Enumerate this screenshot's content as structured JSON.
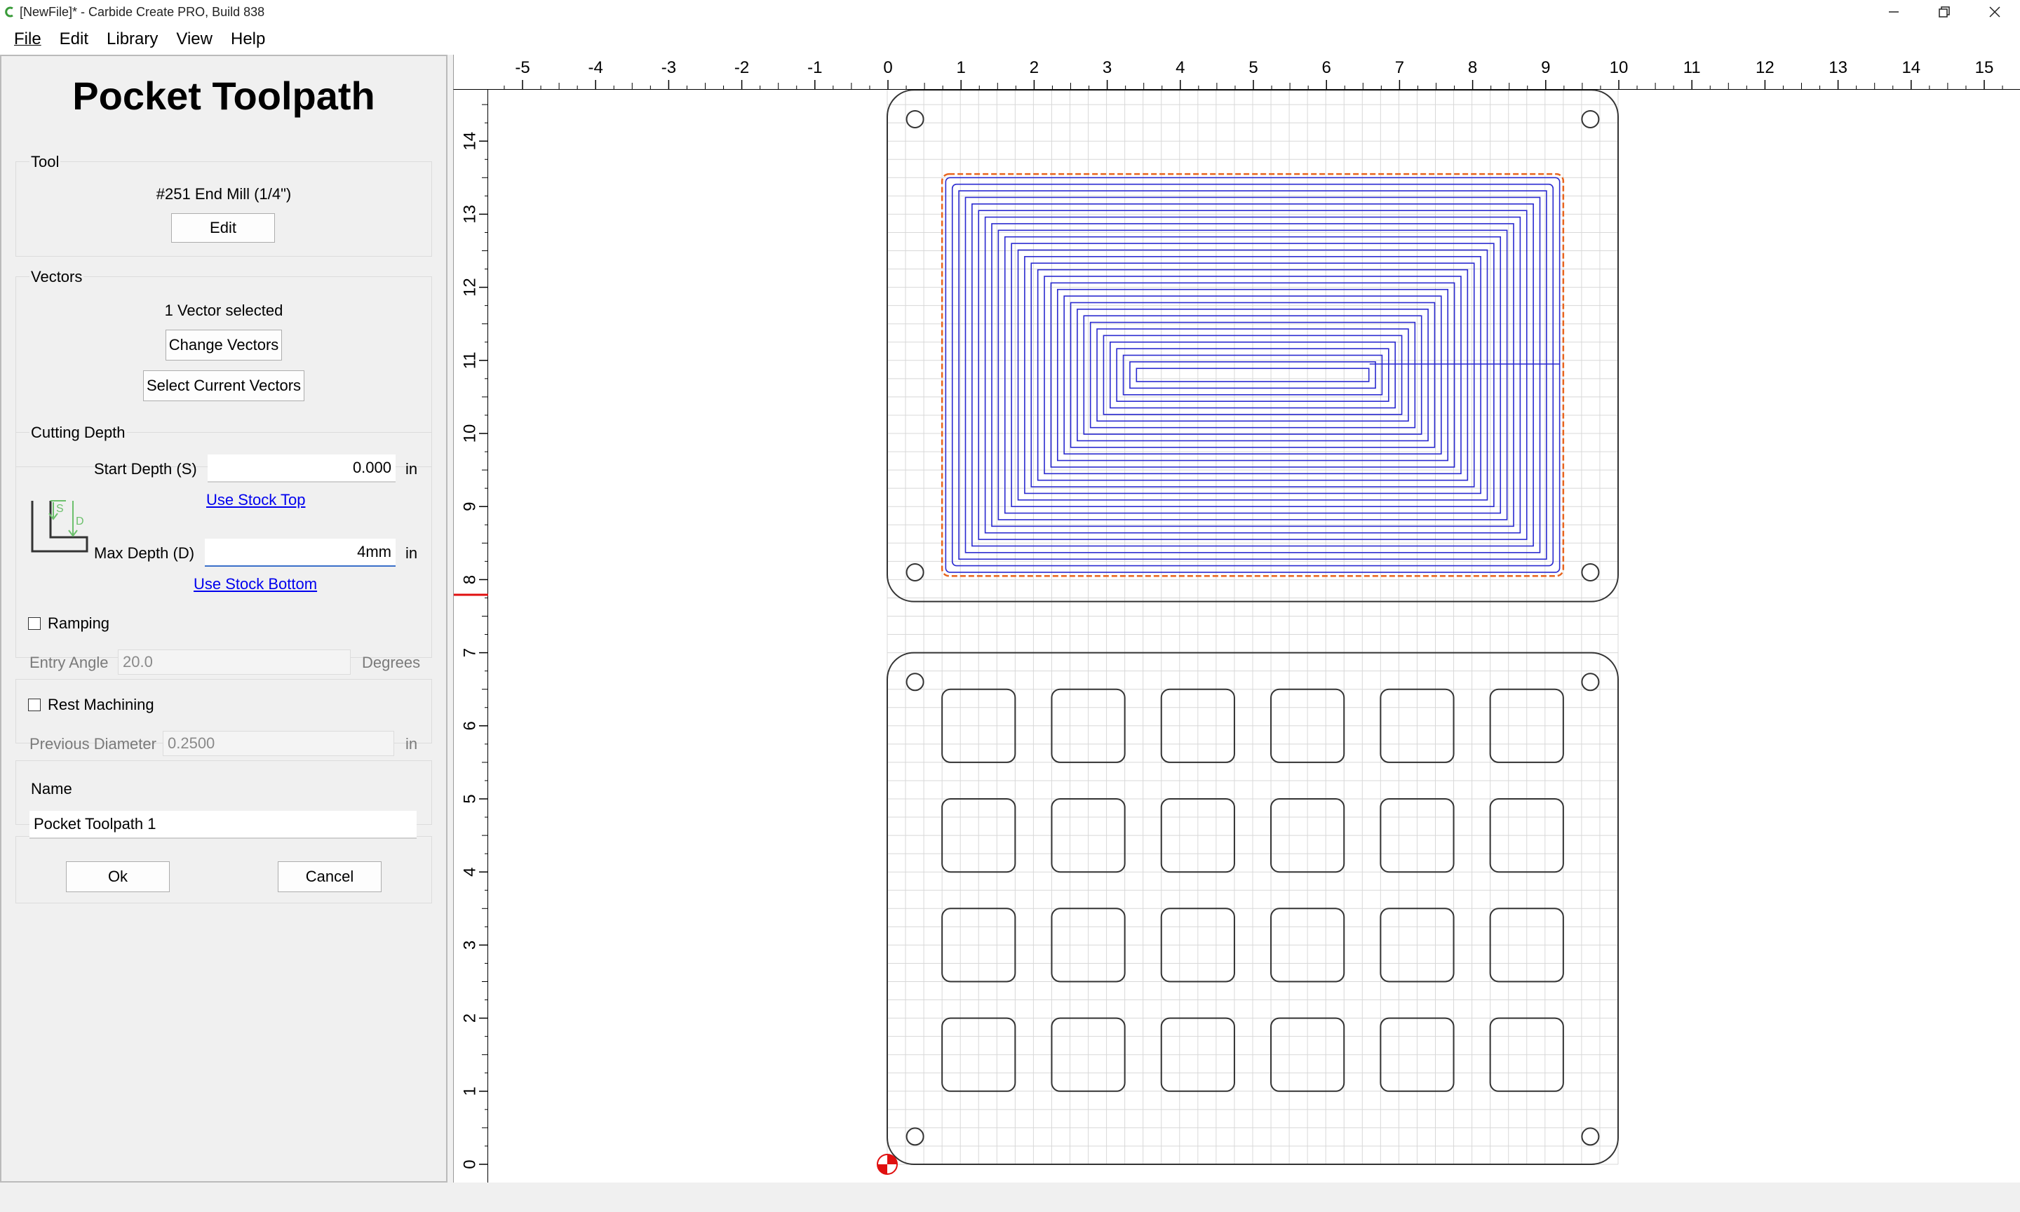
{
  "window": {
    "title": "[NewFile]* - Carbide Create PRO, Build 838",
    "minimize_icon": "minimize-icon",
    "maximize_icon": "restore-icon",
    "close_icon": "close-icon"
  },
  "menu": {
    "file": "File",
    "edit": "Edit",
    "library": "Library",
    "view": "View",
    "help": "Help"
  },
  "panel": {
    "title": "Pocket Toolpath",
    "tool": {
      "label": "Tool",
      "name": "#251 End Mill (1/4\")",
      "edit_button": "Edit"
    },
    "vectors": {
      "label": "Vectors",
      "status": "1 Vector selected",
      "change_button": "Change Vectors",
      "select_button": "Select Current Vectors"
    },
    "cutting_depth": {
      "label": "Cutting Depth",
      "start_label": "Start Depth (S)",
      "start_value": "0.000",
      "start_unit": "in",
      "use_stock_top": "Use Stock Top",
      "max_label": "Max Depth (D)",
      "max_value": "4mm",
      "max_unit": "in",
      "use_stock_bottom": "Use Stock Bottom",
      "diagram_s": "S",
      "diagram_d": "D"
    },
    "ramping": {
      "label": "Ramping",
      "checked": false,
      "entry_angle_label": "Entry Angle",
      "entry_angle_value": "20.0",
      "entry_angle_unit": "Degrees"
    },
    "rest_machining": {
      "label": "Rest Machining",
      "checked": false,
      "prev_diameter_label": "Previous Diameter",
      "prev_diameter_value": "0.2500",
      "prev_diameter_unit": "in"
    },
    "name": {
      "label": "Name",
      "value": "Pocket Toolpath 1"
    },
    "ok_button": "Ok",
    "cancel_button": "Cancel"
  },
  "rulers": {
    "horizontal_labels": [
      "-5",
      "-4",
      "-3",
      "-2",
      "-1",
      "0",
      "1",
      "2",
      "3",
      "4",
      "5",
      "6",
      "7",
      "8",
      "9",
      "10",
      "11",
      "12",
      "13",
      "14",
      "15"
    ],
    "vertical_labels": [
      "0",
      "1",
      "2",
      "3",
      "4",
      "5",
      "6",
      "7",
      "8",
      "9",
      "10",
      "11",
      "12",
      "13",
      "14"
    ]
  },
  "colors": {
    "toolpath": "#2a2ad0",
    "selection": "#e8641e",
    "grid": "#d8d8d8",
    "outline": "#333333",
    "origin": "#e01010"
  }
}
